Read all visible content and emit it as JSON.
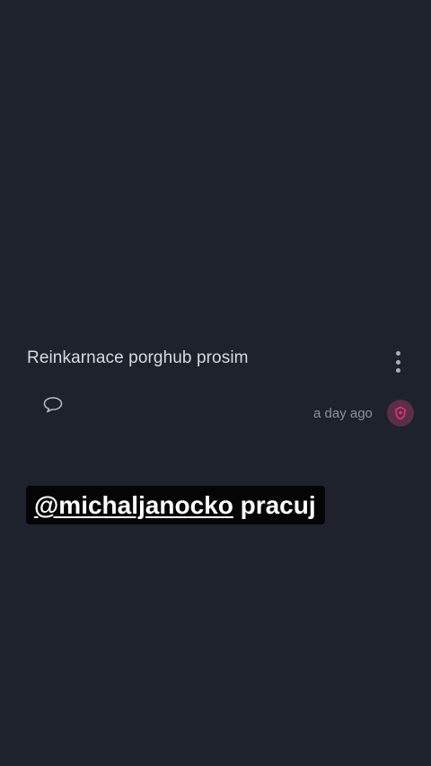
{
  "post": {
    "text": "Reinkarnace porghub prosim",
    "timestamp": "a day ago"
  },
  "caption": {
    "mention": "@michaljanocko",
    "text": "pracuj"
  },
  "icons": {
    "more": "more-vertical-icon",
    "comment": "comment-bubble-icon",
    "avatar": "pink-shield-avatar-icon"
  },
  "colors": {
    "background": "#1d222c",
    "avatar_bg": "#5a2e46",
    "avatar_accent": "#e0336e"
  }
}
